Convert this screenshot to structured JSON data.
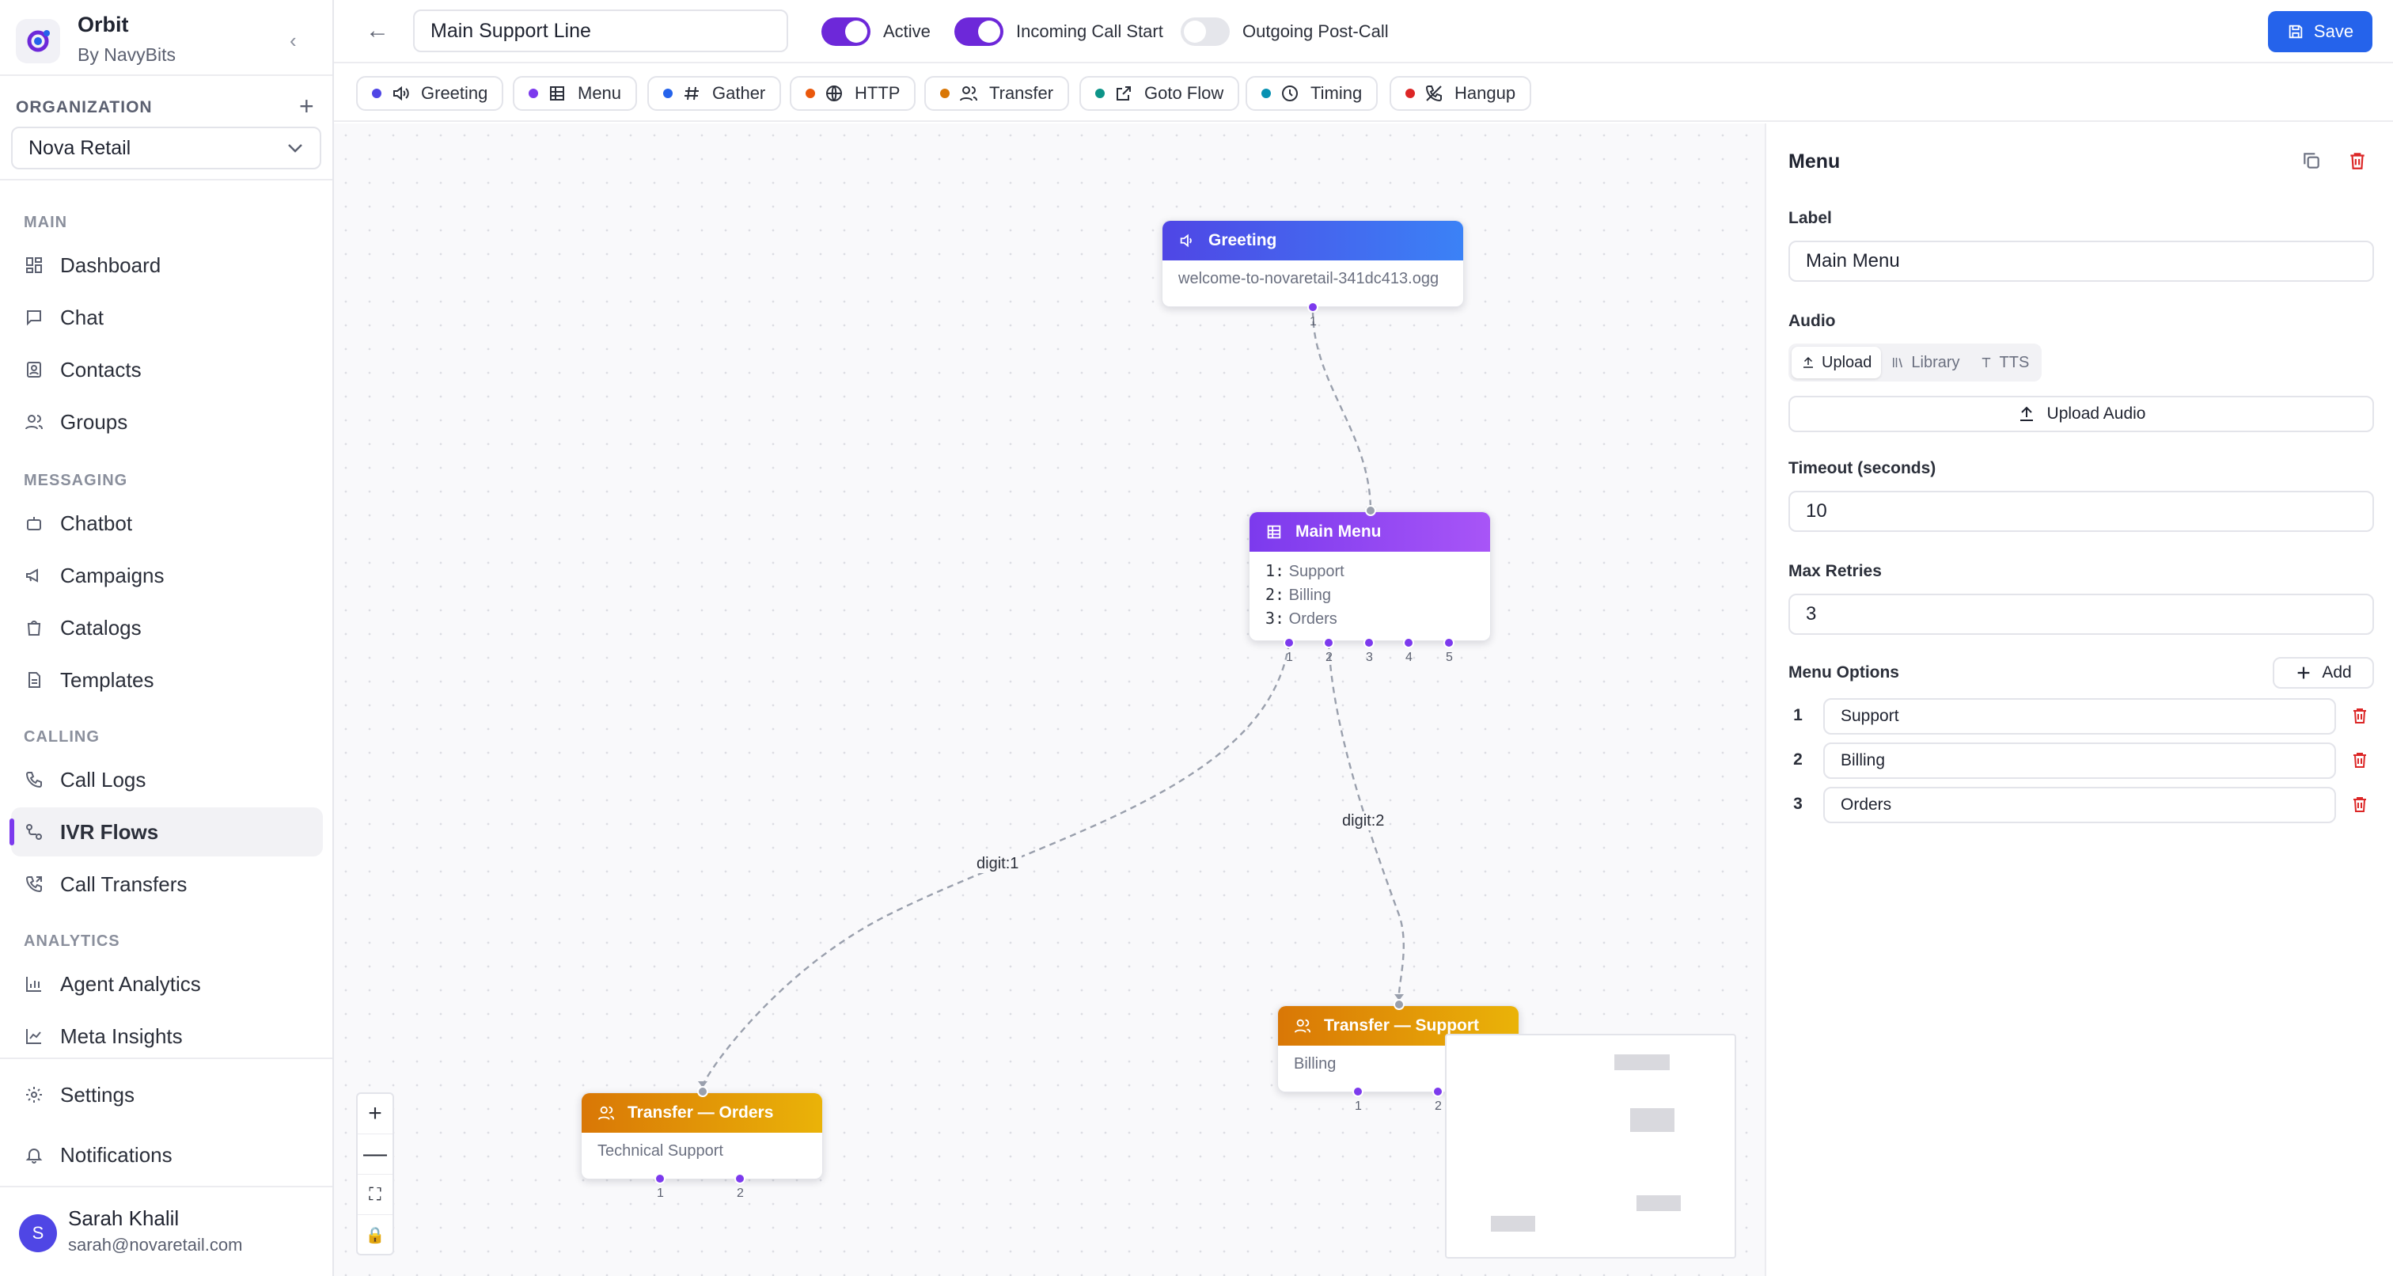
{
  "brand": {
    "title": "Orbit",
    "subtitle": "By NavyBits"
  },
  "organization": {
    "label": "ORGANIZATION",
    "selected": "Nova Retail"
  },
  "sidebar": {
    "sections": [
      {
        "label": "MAIN",
        "items": [
          {
            "label": "Dashboard",
            "icon": "dashboard-icon"
          },
          {
            "label": "Chat",
            "icon": "chat-icon"
          },
          {
            "label": "Contacts",
            "icon": "contacts-icon"
          },
          {
            "label": "Groups",
            "icon": "groups-icon"
          }
        ]
      },
      {
        "label": "MESSAGING",
        "items": [
          {
            "label": "Chatbot",
            "icon": "bot-icon"
          },
          {
            "label": "Campaigns",
            "icon": "megaphone-icon"
          },
          {
            "label": "Catalogs",
            "icon": "bag-icon"
          },
          {
            "label": "Templates",
            "icon": "template-icon"
          }
        ]
      },
      {
        "label": "CALLING",
        "items": [
          {
            "label": "Call Logs",
            "icon": "phone-icon"
          },
          {
            "label": "IVR Flows",
            "icon": "flow-icon",
            "active": true
          },
          {
            "label": "Call Transfers",
            "icon": "phone-forward-icon"
          }
        ]
      },
      {
        "label": "ANALYTICS",
        "items": [
          {
            "label": "Agent Analytics",
            "icon": "bar-chart-icon"
          },
          {
            "label": "Meta Insights",
            "icon": "line-chart-icon"
          }
        ]
      }
    ],
    "bottom": [
      {
        "label": "Settings",
        "icon": "gear-icon"
      },
      {
        "label": "Notifications",
        "icon": "bell-icon"
      }
    ]
  },
  "user": {
    "initial": "S",
    "name": "Sarah Khalil",
    "email": "sarah@novaretail.com"
  },
  "toolbar": {
    "flow_name": "Main Support Line",
    "toggles": [
      {
        "label": "Active",
        "on": true
      },
      {
        "label": "Incoming Call Start",
        "on": true
      },
      {
        "label": "Outgoing Post-Call",
        "on": false
      }
    ],
    "save_label": "Save"
  },
  "palette": [
    {
      "label": "Greeting",
      "dot": "#4f46e5",
      "icon": "speaker-icon"
    },
    {
      "label": "Menu",
      "dot": "#7c3aed",
      "icon": "grid-icon"
    },
    {
      "label": "Gather",
      "dot": "#2563eb",
      "icon": "hash-icon"
    },
    {
      "label": "HTTP",
      "dot": "#ea580c",
      "icon": "globe-icon"
    },
    {
      "label": "Transfer",
      "dot": "#d97706",
      "icon": "users-icon"
    },
    {
      "label": "Goto Flow",
      "dot": "#0d9488",
      "icon": "external-link-icon"
    },
    {
      "label": "Timing",
      "dot": "#0891b2",
      "icon": "clock-icon"
    },
    {
      "label": "Hangup",
      "dot": "#dc2626",
      "icon": "phone-off-icon"
    }
  ],
  "canvas": {
    "nodes": {
      "greeting": {
        "title": "Greeting",
        "body": "welcome-to-novaretail-341dc413.ogg",
        "outputs": [
          "1"
        ]
      },
      "menu": {
        "title": "Main Menu",
        "options": [
          {
            "digit": "1:",
            "label": "Support"
          },
          {
            "digit": "2:",
            "label": "Billing"
          },
          {
            "digit": "3:",
            "label": "Orders"
          }
        ],
        "outputs": [
          "1",
          "2",
          "3",
          "4",
          "5"
        ]
      },
      "transfer_orders": {
        "title": "Transfer — Orders",
        "body": "Technical Support",
        "outputs": [
          "1",
          "2"
        ]
      },
      "transfer_support": {
        "title": "Transfer — Support",
        "body": "Billing",
        "outputs": [
          "1",
          "2"
        ]
      }
    },
    "edge_labels": {
      "digit1": "digit:1",
      "digit2": "digit:2"
    },
    "zoom_controls": [
      "+",
      "—",
      "⛶",
      "🔒"
    ]
  },
  "panel": {
    "title": "Menu",
    "label_field": {
      "label": "Label",
      "value": "Main Menu"
    },
    "audio": {
      "label": "Audio",
      "tabs": [
        "Upload",
        "Library",
        "TTS"
      ],
      "upload_button": "Upload Audio"
    },
    "timeout": {
      "label": "Timeout (seconds)",
      "value": "10"
    },
    "max_retries": {
      "label": "Max Retries",
      "value": "3"
    },
    "menu_options": {
      "label": "Menu Options",
      "add_label": "Add",
      "items": [
        {
          "num": "1",
          "value": "Support"
        },
        {
          "num": "2",
          "value": "Billing"
        },
        {
          "num": "3",
          "value": "Orders"
        }
      ]
    }
  },
  "colors": {
    "accent": "#7c3aed",
    "primary": "#2563eb",
    "danger": "#dc2626"
  }
}
